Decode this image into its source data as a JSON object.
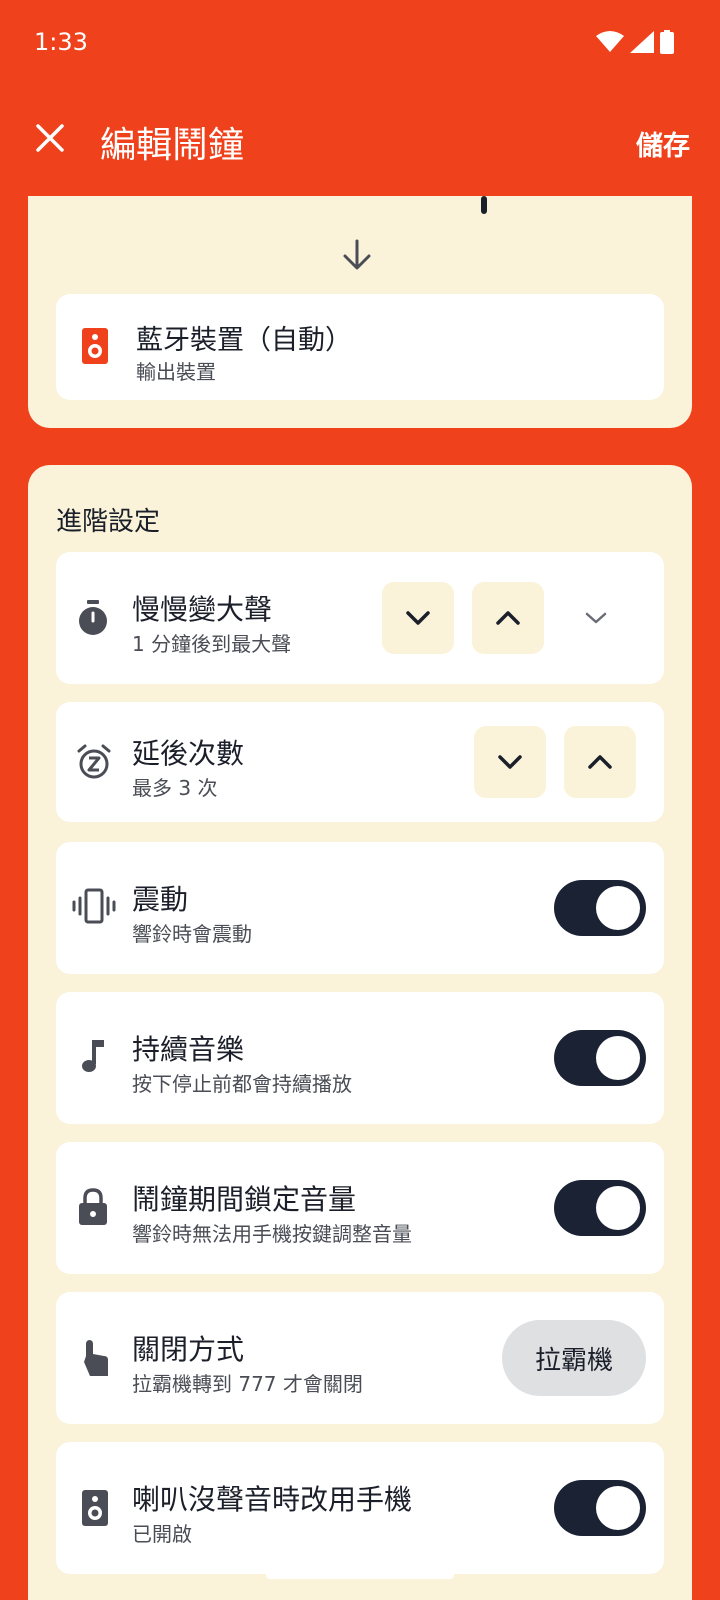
{
  "status_bar": {
    "time": "1:33"
  },
  "app_bar": {
    "title": "編輯鬧鐘",
    "save_label": "儲存"
  },
  "output_device": {
    "title": "藍牙裝置（自動）",
    "subtitle": "輸出裝置"
  },
  "advanced": {
    "section_title": "進階設定",
    "rows": [
      {
        "title": "慢慢變大聲",
        "subtitle": "1 分鐘後到最大聲",
        "control": "stepper-expand"
      },
      {
        "title": "延後次數",
        "subtitle": "最多 3 次",
        "control": "stepper"
      },
      {
        "title": "震動",
        "subtitle": "響鈴時會震動",
        "control": "toggle",
        "on": true
      },
      {
        "title": "持續音樂",
        "subtitle": "按下停止前都會持續播放",
        "control": "toggle",
        "on": true
      },
      {
        "title": "鬧鐘期間鎖定音量",
        "subtitle": "響鈴時無法用手機按鍵調整音量",
        "control": "toggle",
        "on": true
      },
      {
        "title": "關閉方式",
        "subtitle": "拉霸機轉到 777 才會關閉",
        "control": "button",
        "button_label": "拉霸機"
      },
      {
        "title": "喇叭沒聲音時改用手機",
        "subtitle": "已開啟",
        "control": "toggle",
        "on": true
      }
    ]
  },
  "colors": {
    "accent": "#EF411B",
    "card": "#FAF3DA",
    "toggle_on": "#1b2233"
  },
  "icons": [
    "close-icon",
    "arrow-down-icon",
    "speaker-icon",
    "timer-icon",
    "snooze-icon",
    "vibrate-icon",
    "music-note-icon",
    "lock-icon",
    "tap-icon"
  ]
}
